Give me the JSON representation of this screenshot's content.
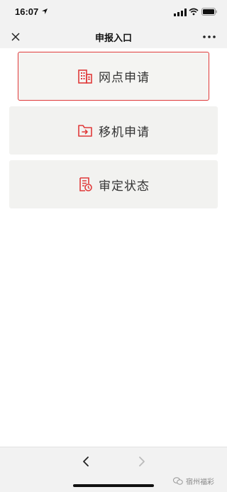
{
  "status_bar": {
    "time": "16:07"
  },
  "nav": {
    "title": "申报入口"
  },
  "menu": {
    "items": [
      {
        "label": "网点申请",
        "icon": "building-icon",
        "selected": true
      },
      {
        "label": "移机申请",
        "icon": "folder-move-icon",
        "selected": false
      },
      {
        "label": "审定状态",
        "icon": "document-clock-icon",
        "selected": false
      }
    ]
  },
  "watermark": {
    "text": "宿州福彩"
  },
  "colors": {
    "accent": "#e03a3a",
    "card_bg": "#f2f2f0",
    "bar_bg": "#f2f2f2"
  }
}
